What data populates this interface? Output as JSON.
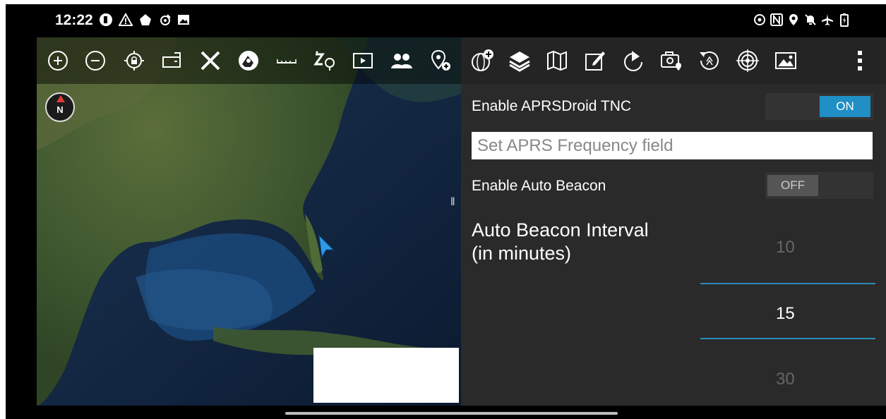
{
  "status_bar": {
    "time": "12:22",
    "left_icons": [
      "app-icon",
      "warning-icon",
      "notification-icon",
      "signal-icon",
      "gallery-icon"
    ],
    "right_icons": [
      "location-tracking-icon",
      "nfc-icon",
      "location-icon",
      "mute-icon",
      "airplane-mode-icon",
      "battery-charging-icon"
    ]
  },
  "toolbar": {
    "left_tools": [
      "zoom-in-icon",
      "zoom-out-icon",
      "lock-location-icon",
      "rotate-map-icon",
      "close-icon",
      "rubber-sheet-icon",
      "measure-icon",
      "distance-icon",
      "play-icon",
      "contacts-icon",
      "add-location-icon"
    ],
    "right_tools": [
      "add-layer-globe-icon",
      "layers-icon",
      "map-icon",
      "edit-icon",
      "bearing-icon",
      "camera-location-icon",
      "reset-icon",
      "target-icon",
      "image-icon",
      "overflow-menu-icon"
    ]
  },
  "map": {
    "compass_label": "N"
  },
  "settings": {
    "tnc_label": "Enable APRSDroid TNC",
    "tnc_toggle": "ON",
    "frequency_placeholder": "Set APRS Frequency field",
    "beacon_label": "Enable Auto Beacon",
    "beacon_toggle": "OFF",
    "interval_label_line1": "Auto Beacon Interval",
    "interval_label_line2": "(in minutes)",
    "interval_options": [
      "10",
      "15",
      "30"
    ],
    "interval_selected": "15"
  },
  "colors": {
    "accent": "#1f8fc5",
    "panel_bg": "#2a2a2a",
    "toolbar_bg": "#242424"
  }
}
